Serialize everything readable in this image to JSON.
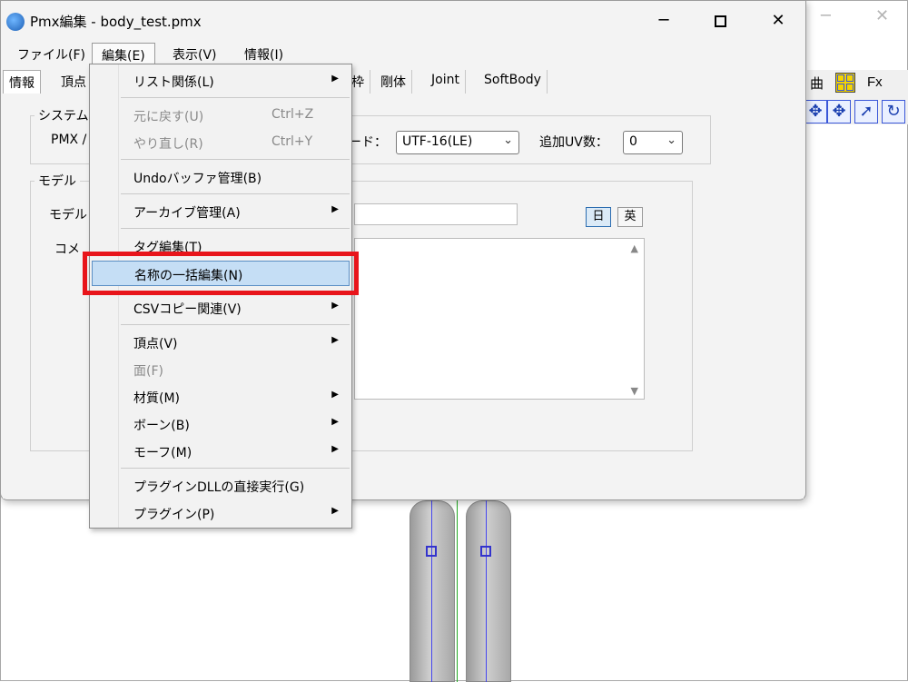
{
  "background_window": {
    "minimize": "─",
    "close": "✕",
    "toolbar": {
      "curve_label": "曲",
      "fx_label": "Fx"
    }
  },
  "main_window": {
    "title": "Pmx編集 - body_test.pmx",
    "minimize": "─",
    "close": "✕"
  },
  "menubar": {
    "file": "ファイル(F)",
    "edit": "編集(E)",
    "view": "表示(V)",
    "info": "情報(I)"
  },
  "tabs": {
    "info": "情報",
    "vertex": "頂点",
    "frame": "枠",
    "rigid": "剛体",
    "joint": "Joint",
    "softbody": "SoftBody"
  },
  "system": {
    "legend": "システム",
    "pmx_label": "PMX /",
    "encode_label": "ード：",
    "encode_value": "UTF-16(LE)",
    "adduv_label": "追加UV数：",
    "adduv_value": "0"
  },
  "model": {
    "legend": "モデル",
    "name_label": "モデル",
    "comment_label": "コメ",
    "lang_jp": "日",
    "lang_en": "英"
  },
  "edit_menu": {
    "list": "リスト関係(L)",
    "undo": "元に戻す(U)",
    "undo_key": "Ctrl+Z",
    "redo": "やり直し(R)",
    "redo_key": "Ctrl+Y",
    "undo_buffer": "Undoバッファ管理(B)",
    "archive": "アーカイブ管理(A)",
    "tag_edit": "タグ編集(T)",
    "batch_name": "名称の一括編集(N)",
    "csv_copy": "CSVコピー関連(V)",
    "vertex": "頂点(V)",
    "face": "面(F)",
    "material": "材質(M)",
    "bone": "ボーン(B)",
    "morph": "モーフ(M)",
    "plugin_dll": "プラグインDLLの直接実行(G)",
    "plugin": "プラグイン(P)"
  },
  "colors": {
    "highlight_border": "#e8151b",
    "menu_selected": "#c5def5"
  }
}
